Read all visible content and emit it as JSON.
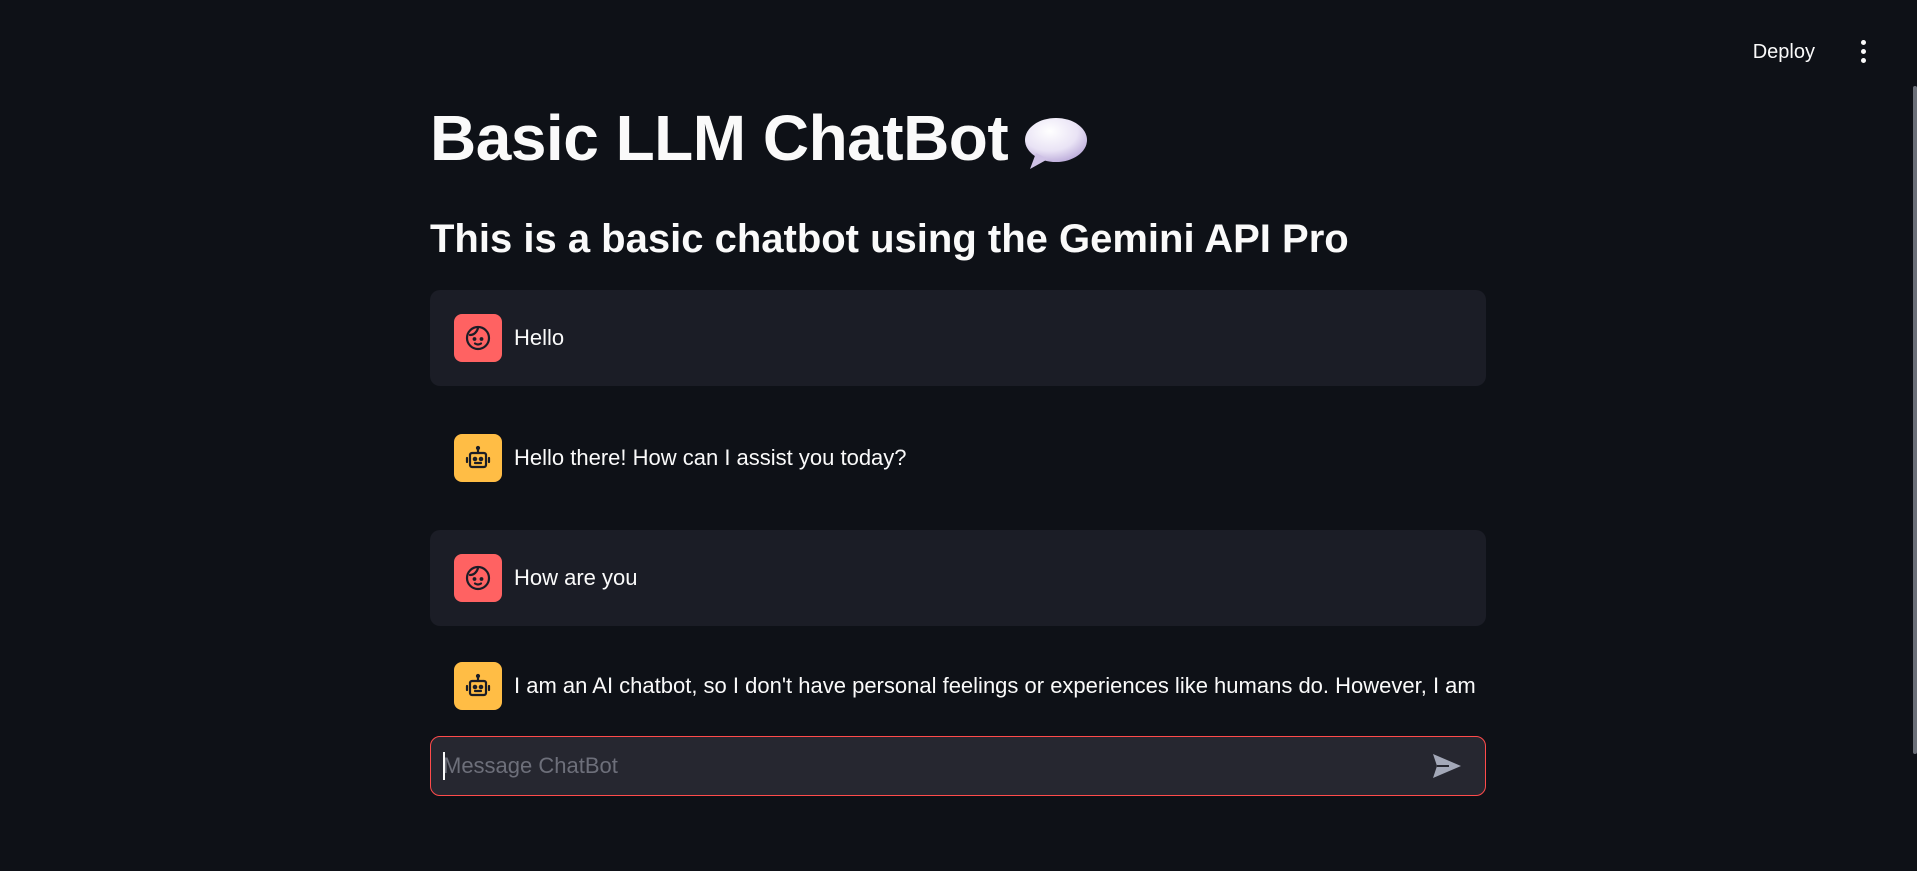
{
  "header": {
    "deploy_label": "Deploy",
    "menu_icon": "more-vertical-icon"
  },
  "page": {
    "title": "Basic LLM ChatBot",
    "title_icon": "speech-balloon-icon",
    "subtitle": "This is a basic chatbot using the Gemini API Pro"
  },
  "messages": [
    {
      "role": "user",
      "avatar_icon": "user-face-icon",
      "text": "Hello"
    },
    {
      "role": "assistant",
      "avatar_icon": "robot-icon",
      "text": "Hello there! How can I assist you today?"
    },
    {
      "role": "user",
      "avatar_icon": "user-face-icon",
      "text": "How are you"
    },
    {
      "role": "assistant",
      "avatar_icon": "robot-icon",
      "text": "I am an AI chatbot, so I don't have personal feelings or experiences like humans do. However, I am"
    }
  ],
  "chat_input": {
    "placeholder": "Message ChatBot",
    "value": "",
    "send_icon": "send-icon"
  },
  "colors": {
    "background": "#0e1117",
    "user_avatar": "#ff6262",
    "assistant_avatar": "#ffbd45",
    "user_bubble": "#1b1d26",
    "input_border": "#ff4b4b"
  }
}
